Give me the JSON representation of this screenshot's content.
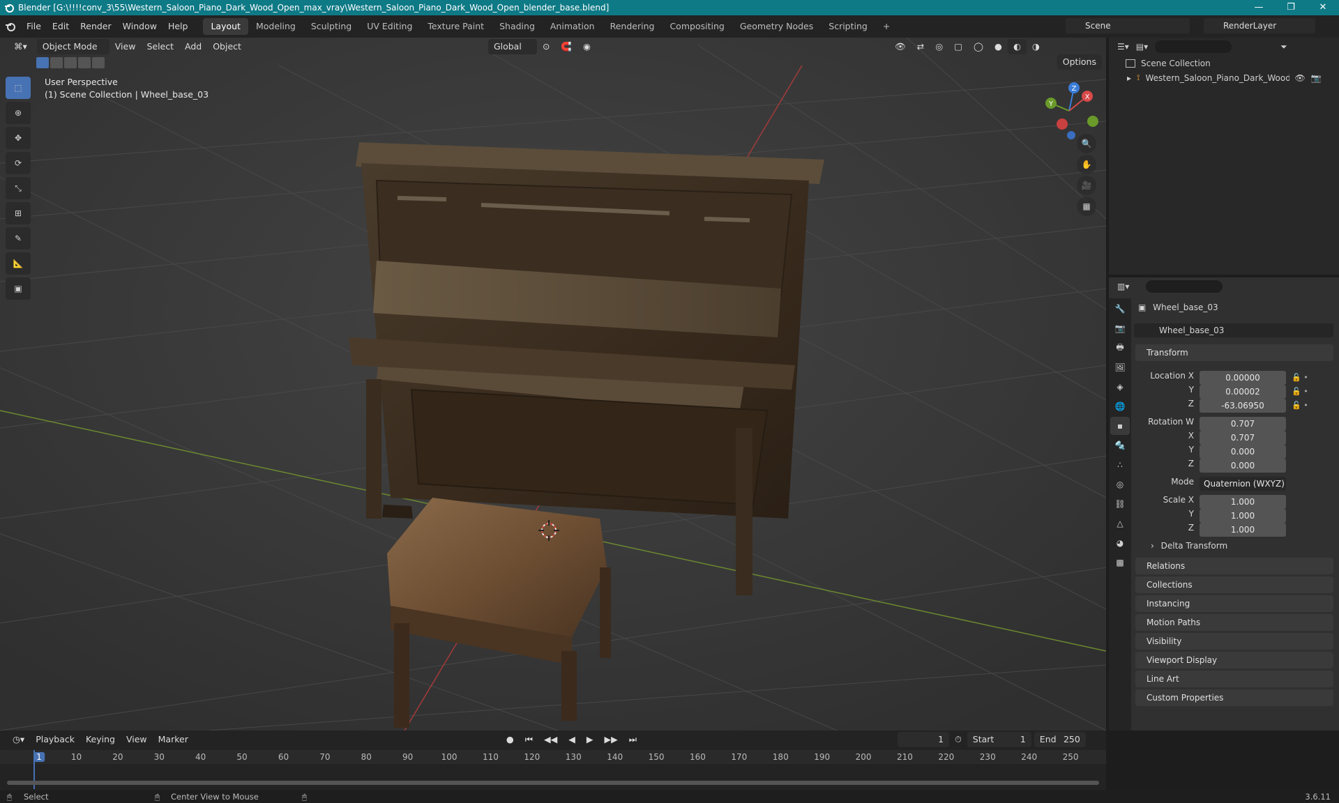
{
  "window": {
    "title": "Blender [G:\\!!!!conv_3\\55\\Western_Saloon_Piano_Dark_Wood_Open_max_vray\\Western_Saloon_Piano_Dark_Wood_Open_blender_base.blend]",
    "min": "—",
    "max": "❐",
    "close": "✕"
  },
  "menu": [
    "File",
    "Edit",
    "Render",
    "Window",
    "Help"
  ],
  "workspaces": [
    "Layout",
    "Modeling",
    "Sculpting",
    "UV Editing",
    "Texture Paint",
    "Shading",
    "Animation",
    "Rendering",
    "Compositing",
    "Geometry Nodes",
    "Scripting"
  ],
  "workspace_add": "+",
  "scene": {
    "name": "Scene",
    "render_layer": "RenderLayer"
  },
  "viewport": {
    "mode": "Object Mode",
    "menus": [
      "View",
      "Select",
      "Add",
      "Object"
    ],
    "orientation": "Global",
    "options": "Options",
    "perspective": "User Perspective",
    "collection_info": "(1) Scene Collection | Wheel_base_03",
    "gizmo_labels": {
      "z": "Z",
      "y": "Y",
      "x": "X"
    }
  },
  "outliner": {
    "root": "Scene Collection",
    "items": [
      {
        "name": "Western_Saloon_Piano_Dark_Wood_Ope"
      }
    ]
  },
  "properties": {
    "object_name": "Wheel_base_03",
    "data_name": "Wheel_base_03",
    "transform": {
      "header": "Transform",
      "location_label": "Location X",
      "location": [
        "0.00000",
        "0.00002",
        "-63.06950"
      ],
      "rotation_label": "Rotation W",
      "rotation": [
        "0.707",
        "0.707",
        "0.000",
        "0.000"
      ],
      "mode_label": "Mode",
      "mode": "Quaternion (WXYZ)",
      "scale_label": "Scale X",
      "scale": [
        "1.000",
        "1.000",
        "1.000"
      ],
      "axis": {
        "x": "X",
        "y": "Y",
        "z": "Z"
      },
      "delta": "Delta Transform"
    },
    "panels": [
      "Relations",
      "Collections",
      "Instancing",
      "Motion Paths",
      "Visibility",
      "Viewport Display",
      "Line Art",
      "Custom Properties"
    ]
  },
  "timeline": {
    "menus": [
      "Playback",
      "Keying",
      "View",
      "Marker"
    ],
    "current_frame": "1",
    "start_label": "Start",
    "start": "1",
    "end_label": "End",
    "end": "250",
    "ticks": [
      "1",
      "10",
      "20",
      "30",
      "40",
      "50",
      "60",
      "70",
      "80",
      "90",
      "100",
      "110",
      "120",
      "130",
      "140",
      "150",
      "160",
      "170",
      "180",
      "190",
      "200",
      "210",
      "220",
      "230",
      "240",
      "250"
    ]
  },
  "status": {
    "select": "Select",
    "center": "Center View to Mouse",
    "version": "3.6.11"
  }
}
